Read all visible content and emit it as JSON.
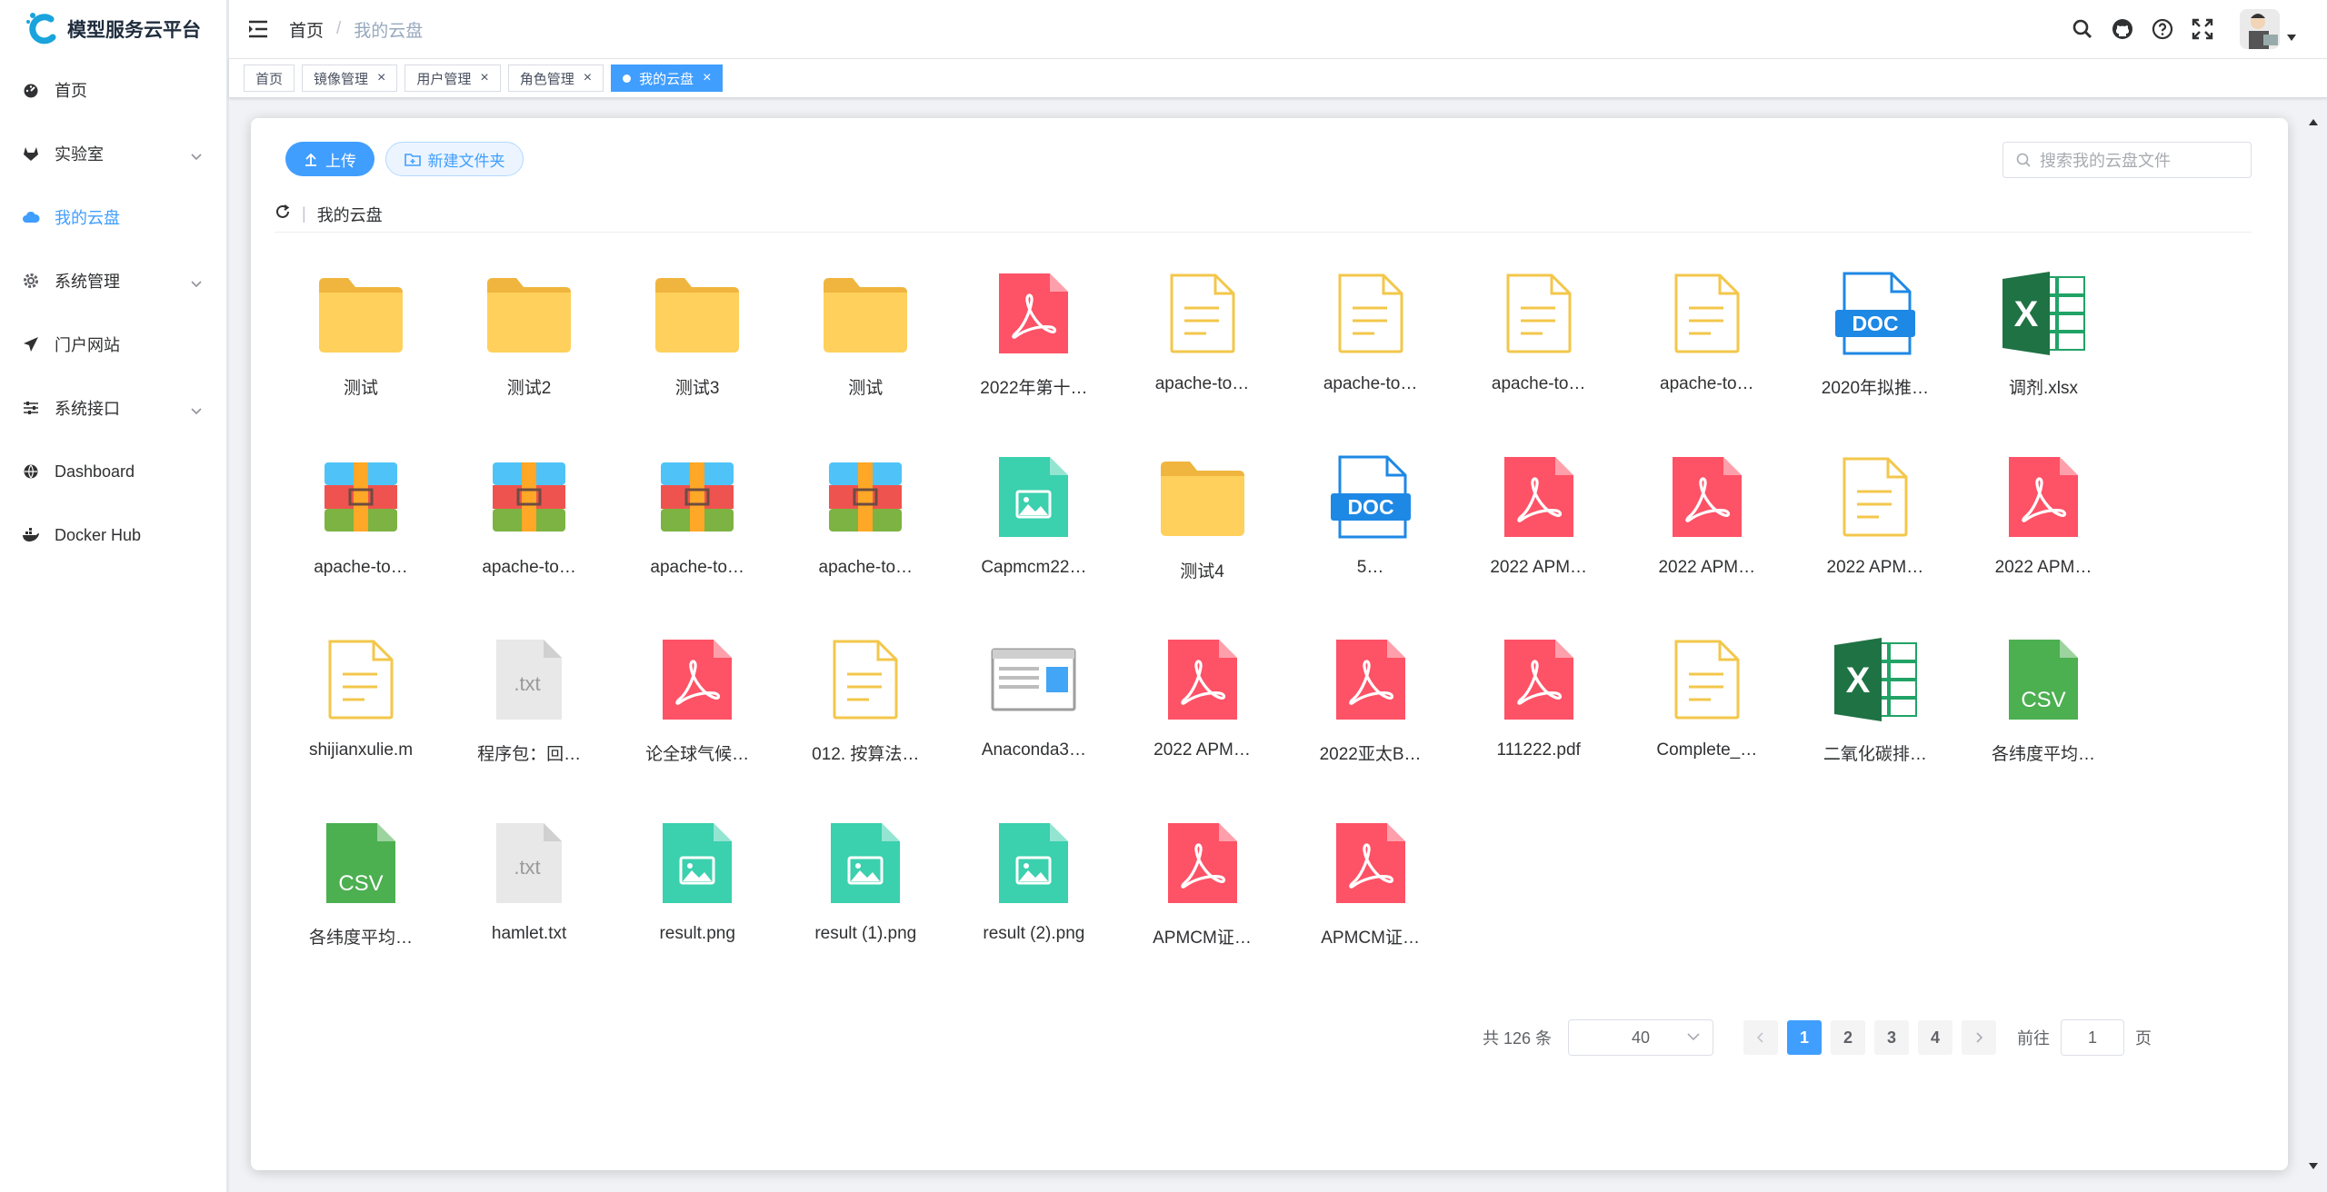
{
  "app": {
    "title": "模型服务云平台"
  },
  "sidebar": {
    "items": [
      {
        "label": "首页",
        "icon": "dashboard-icon",
        "has_children": false,
        "active": false
      },
      {
        "label": "实验室",
        "icon": "gitlab-icon",
        "has_children": true,
        "active": false
      },
      {
        "label": "我的云盘",
        "icon": "cloud-icon",
        "has_children": false,
        "active": true
      },
      {
        "label": "系统管理",
        "icon": "gear-icon",
        "has_children": true,
        "active": false
      },
      {
        "label": "门户网站",
        "icon": "send-icon",
        "has_children": false,
        "active": false
      },
      {
        "label": "系统接口",
        "icon": "sliders-icon",
        "has_children": true,
        "active": false
      },
      {
        "label": "Dashboard",
        "icon": "globe-icon",
        "has_children": false,
        "active": false
      },
      {
        "label": "Docker Hub",
        "icon": "docker-icon",
        "has_children": false,
        "active": false
      }
    ]
  },
  "header": {
    "breadcrumb": [
      "首页",
      "我的云盘"
    ],
    "icons": [
      "search-icon",
      "github-icon",
      "question-icon",
      "fullscreen-icon"
    ]
  },
  "tags": [
    {
      "label": "首页",
      "closable": false,
      "active": false
    },
    {
      "label": "镜像管理",
      "closable": true,
      "active": false
    },
    {
      "label": "用户管理",
      "closable": true,
      "active": false
    },
    {
      "label": "角色管理",
      "closable": true,
      "active": false
    },
    {
      "label": "我的云盘",
      "closable": true,
      "active": true
    }
  ],
  "toolbar": {
    "upload_label": "上传",
    "new_folder_label": "新建文件夹",
    "search_placeholder": "搜索我的云盘文件"
  },
  "path": {
    "current": "我的云盘"
  },
  "files": [
    {
      "name": "测试",
      "type": "folder"
    },
    {
      "name": "测试2",
      "type": "folder"
    },
    {
      "name": "测试3",
      "type": "folder"
    },
    {
      "name": "测试",
      "type": "folder"
    },
    {
      "name": "2022年第十…",
      "type": "pdf"
    },
    {
      "name": "apache-to…",
      "type": "doc-outline"
    },
    {
      "name": "apache-to…",
      "type": "doc-outline"
    },
    {
      "name": "apache-to…",
      "type": "doc-outline"
    },
    {
      "name": "apache-to…",
      "type": "doc-outline"
    },
    {
      "name": "2020年拟推…",
      "type": "word"
    },
    {
      "name": "调剂.xlsx",
      "type": "excel"
    },
    {
      "name": "apache-to…",
      "type": "archive"
    },
    {
      "name": "apache-to…",
      "type": "archive"
    },
    {
      "name": "apache-to…",
      "type": "archive"
    },
    {
      "name": "apache-to…",
      "type": "archive"
    },
    {
      "name": "Capmcm22…",
      "type": "image"
    },
    {
      "name": "测试4",
      "type": "folder"
    },
    {
      "name": "5…",
      "type": "word-outline"
    },
    {
      "name": "2022 APM…",
      "type": "pdf"
    },
    {
      "name": "2022 APM…",
      "type": "pdf"
    },
    {
      "name": "2022 APM…",
      "type": "doc-outline"
    },
    {
      "name": "2022 APM…",
      "type": "pdf"
    },
    {
      "name": "shijianxulie.m",
      "type": "doc-outline"
    },
    {
      "name": "程序包：回…",
      "type": "txt"
    },
    {
      "name": "论全球气候…",
      "type": "pdf"
    },
    {
      "name": "012. 按算法…",
      "type": "doc-outline"
    },
    {
      "name": "Anaconda3…",
      "type": "exe"
    },
    {
      "name": "2022 APM…",
      "type": "pdf"
    },
    {
      "name": "2022亚太B…",
      "type": "pdf"
    },
    {
      "name": "111222.pdf",
      "type": "pdf"
    },
    {
      "name": "Complete_…",
      "type": "doc-outline"
    },
    {
      "name": "二氧化碳排…",
      "type": "excel"
    },
    {
      "name": "各纬度平均…",
      "type": "csv"
    },
    {
      "name": "各纬度平均…",
      "type": "csv"
    },
    {
      "name": "hamlet.txt",
      "type": "txt"
    },
    {
      "name": "result.png",
      "type": "image"
    },
    {
      "name": "result (1).png",
      "type": "image"
    },
    {
      "name": "result (2).png",
      "type": "image"
    },
    {
      "name": "APMCM证…",
      "type": "pdf"
    },
    {
      "name": "APMCM证…",
      "type": "pdf"
    }
  ],
  "pagination": {
    "total_label": "共 126 条",
    "page_size": "40",
    "pages": [
      "1",
      "2",
      "3",
      "4"
    ],
    "current": "1",
    "goto_label": "前往",
    "goto_value": "1",
    "page_suffix": "页"
  },
  "colors": {
    "primary": "#409eff",
    "folder": "#ffd05c",
    "pdf": "#fe5266",
    "doc_outline": "#f3c74b",
    "excel": "#1f7244",
    "image": "#3bd0ae",
    "csv": "#4caf50"
  }
}
